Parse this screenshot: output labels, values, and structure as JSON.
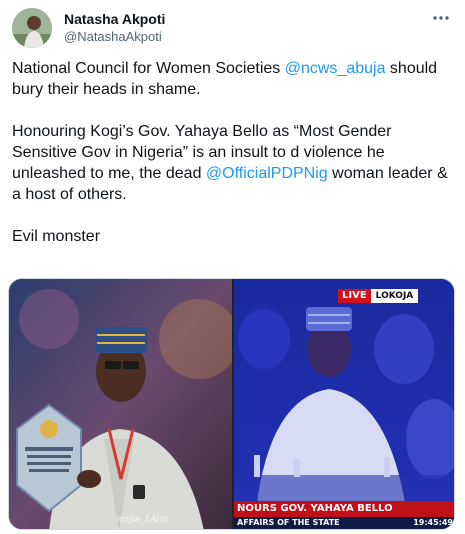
{
  "author": {
    "display_name": "Natasha Akpoti",
    "handle": "@NatashaAkpoti",
    "avatar_icon": "profile-photo"
  },
  "tweet": {
    "p1_text": "National Council for Women Societies ",
    "p1_mention": "@ncws_abuja",
    "p1_tail": " should bury their heads in shame.",
    "p2_text": "Honouring Kogi’s Gov. Yahaya Bello as “Most Gender Sensitive Gov in Nigeria” is an insult to d violence he unleashed to me, the dead ",
    "p2_mention": "@OfficialPDPNig",
    "p2_tail": " woman leader & a host of others.",
    "p3_text": "Evil monster"
  },
  "media": {
    "left_watermark": "Itopa_1Arts",
    "right": {
      "live_label": "LIVE",
      "location": "LOKOJA",
      "headline": "NOURS GOV. YAHAYA BELLO",
      "subline": "AFFAIRS OF THE STATE",
      "time": "19:45:49"
    }
  },
  "colors": {
    "mention": "#1d9bf0",
    "text": "#0f1419",
    "secondary": "#536471",
    "live_red": "#d1121b"
  }
}
